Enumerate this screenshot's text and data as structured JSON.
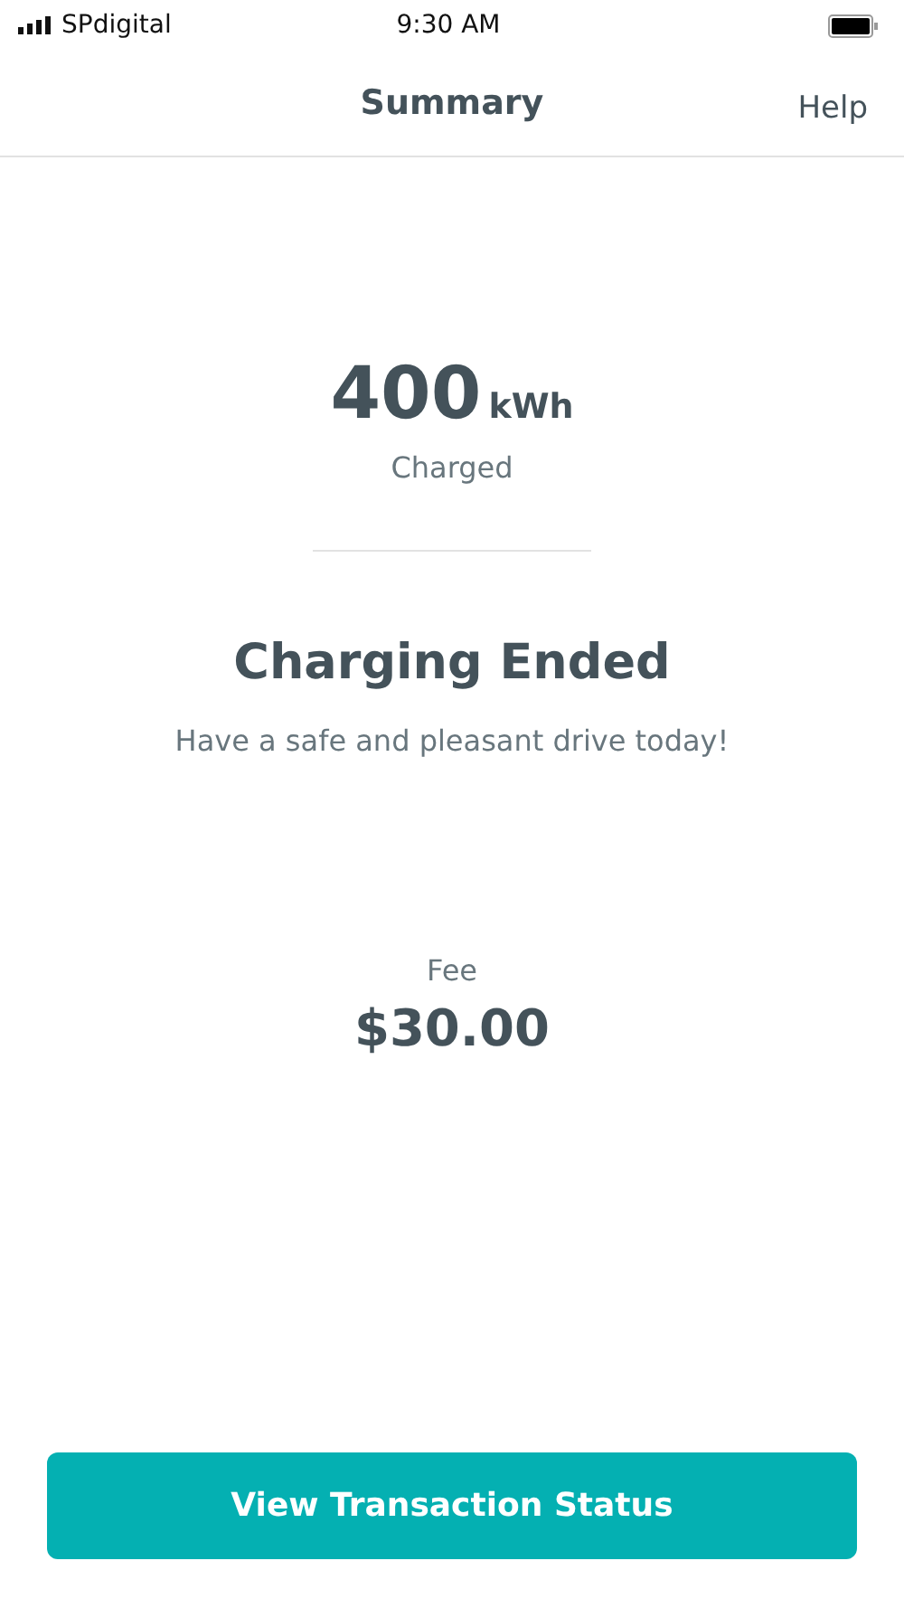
{
  "status_bar": {
    "carrier": "SPdigital",
    "time": "9:30 AM"
  },
  "nav": {
    "title": "Summary",
    "action": "Help"
  },
  "energy": {
    "amount": "400",
    "unit": "kWh",
    "label": "Charged"
  },
  "status": {
    "title": "Charging Ended",
    "message": "Have a safe and pleasant drive today!"
  },
  "fee": {
    "label": "Fee",
    "amount": "$30.00"
  },
  "primary_button": "View Transaction Status"
}
